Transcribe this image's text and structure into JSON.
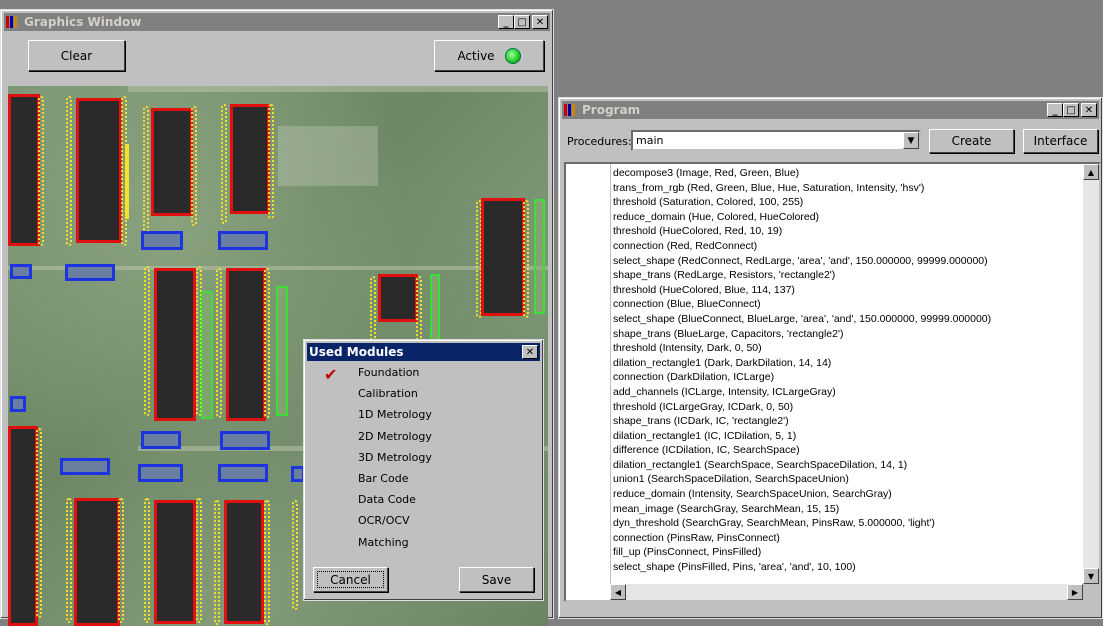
{
  "graphics_window": {
    "title": "Graphics Window",
    "clear_label": "Clear",
    "active_label": "Active"
  },
  "program_window": {
    "title": "Program",
    "procedures_label": "Procedures:",
    "procedure_value": "main",
    "create_label": "Create",
    "interface_label": "Interface",
    "code_lines": [
      "decompose3 (Image, Red, Green, Blue)",
      "trans_from_rgb (Red, Green, Blue, Hue, Saturation, Intensity, 'hsv')",
      "threshold (Saturation, Colored, 100, 255)",
      "reduce_domain (Hue, Colored, HueColored)",
      "threshold (HueColored, Red, 10, 19)",
      "connection (Red, RedConnect)",
      "select_shape (RedConnect, RedLarge, 'area', 'and', 150.000000, 99999.000000)",
      "shape_trans (RedLarge, Resistors, 'rectangle2')",
      "threshold (HueColored, Blue, 114, 137)",
      "connection (Blue, BlueConnect)",
      "select_shape (BlueConnect, BlueLarge, 'area', 'and', 150.000000, 99999.000000)",
      "shape_trans (BlueLarge, Capacitors, 'rectangle2')",
      "threshold (Intensity, Dark, 0, 50)",
      "dilation_rectangle1 (Dark, DarkDilation, 14, 14)",
      "connection (DarkDilation, ICLarge)",
      "add_channels (ICLarge, Intensity, ICLargeGray)",
      "threshold (ICLargeGray, ICDark, 0, 50)",
      "shape_trans (ICDark, IC, 'rectangle2')",
      "dilation_rectangle1 (IC, ICDilation, 5, 1)",
      "difference (ICDilation, IC, SearchSpace)",
      "dilation_rectangle1 (SearchSpace, SearchSpaceDilation, 14, 1)",
      "union1 (SearchSpaceDilation, SearchSpaceUnion)",
      "reduce_domain (Intensity, SearchSpaceUnion, SearchGray)",
      "mean_image (SearchGray, SearchMean, 15, 15)",
      "dyn_threshold (SearchGray, SearchMean, PinsRaw, 5.000000, 'light')",
      "connection (PinsRaw, PinsConnect)",
      "fill_up (PinsConnect, PinsFilled)",
      "select_shape (PinsFilled, Pins, 'area', 'and', 10, 100)"
    ]
  },
  "used_modules": {
    "title": "Used Modules",
    "items": [
      {
        "label": "Foundation",
        "checked": true
      },
      {
        "label": "Calibration",
        "checked": false
      },
      {
        "label": "1D Metrology",
        "checked": false
      },
      {
        "label": "2D Metrology",
        "checked": false
      },
      {
        "label": "3D Metrology",
        "checked": false
      },
      {
        "label": "Bar Code",
        "checked": false
      },
      {
        "label": "Data Code",
        "checked": false
      },
      {
        "label": "OCR/OCV",
        "checked": false
      },
      {
        "label": "Matching",
        "checked": false
      }
    ],
    "cancel_label": "Cancel",
    "save_label": "Save"
  },
  "colors": {
    "ic_outline": "#e01010",
    "pin_marks": "#f5e12a",
    "resistor_outline": "#1d35e0",
    "capacitor_outline": "#3adf3a",
    "led_active": "#1ec81e"
  }
}
